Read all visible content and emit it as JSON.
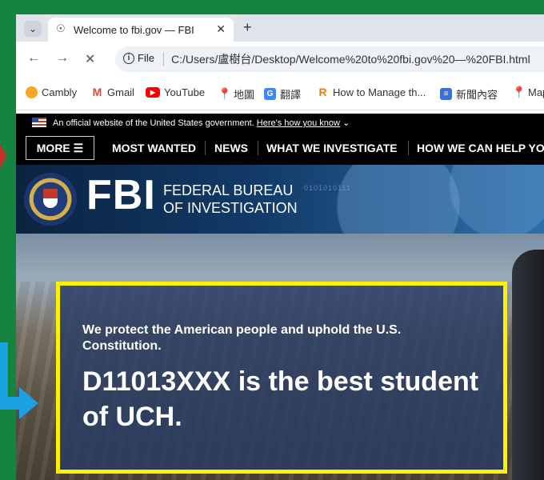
{
  "browser": {
    "tab_title": "Welcome to fbi.gov — FBI",
    "new_tab_symbol": "+",
    "close_symbol": "✕",
    "file_label": "File",
    "url": "C:/Users/盧樹台/Desktop/Welcome%20to%20fbi.gov%20—%20FBI.html"
  },
  "bookmarks": [
    {
      "label": "Cambly",
      "icon": "cambly-icon",
      "color": "#f5a623"
    },
    {
      "label": "Gmail",
      "icon": "gmail-icon",
      "color": "#ea4335"
    },
    {
      "label": "YouTube",
      "icon": "youtube-icon",
      "color": "#ff0000"
    },
    {
      "label": "地圖",
      "icon": "maps-icon",
      "color": "#34a853"
    },
    {
      "label": "翻譯",
      "icon": "translate-icon",
      "color": "#4285f4"
    },
    {
      "label": "How to Manage th...",
      "icon": "r-icon",
      "color": "#f57c00"
    },
    {
      "label": "新聞內容",
      "icon": "news-icon",
      "color": "#3b6fd6"
    },
    {
      "label": "Map",
      "icon": "maps-icon-2",
      "color": "#34a853"
    }
  ],
  "gov_banner": {
    "text": "An official website of the United States government.",
    "link": "Here's how you know"
  },
  "nav": {
    "more": "MORE ☰",
    "items": [
      "MOST WANTED",
      "NEWS",
      "WHAT WE INVESTIGATE",
      "HOW WE CAN HELP YO"
    ]
  },
  "header": {
    "acronym": "FBI",
    "line1": "FEDERAL BUREAU",
    "line2": "OF INVESTIGATION",
    "binary": "0101010111"
  },
  "card": {
    "subtitle": "We protect the American people and uphold the U.S. Constitution.",
    "headline": "D11013XXX is the best student of UCH."
  },
  "colors": {
    "frame": "#15843f",
    "highlight": "#fff200",
    "arrow": "#1ba1e2"
  }
}
